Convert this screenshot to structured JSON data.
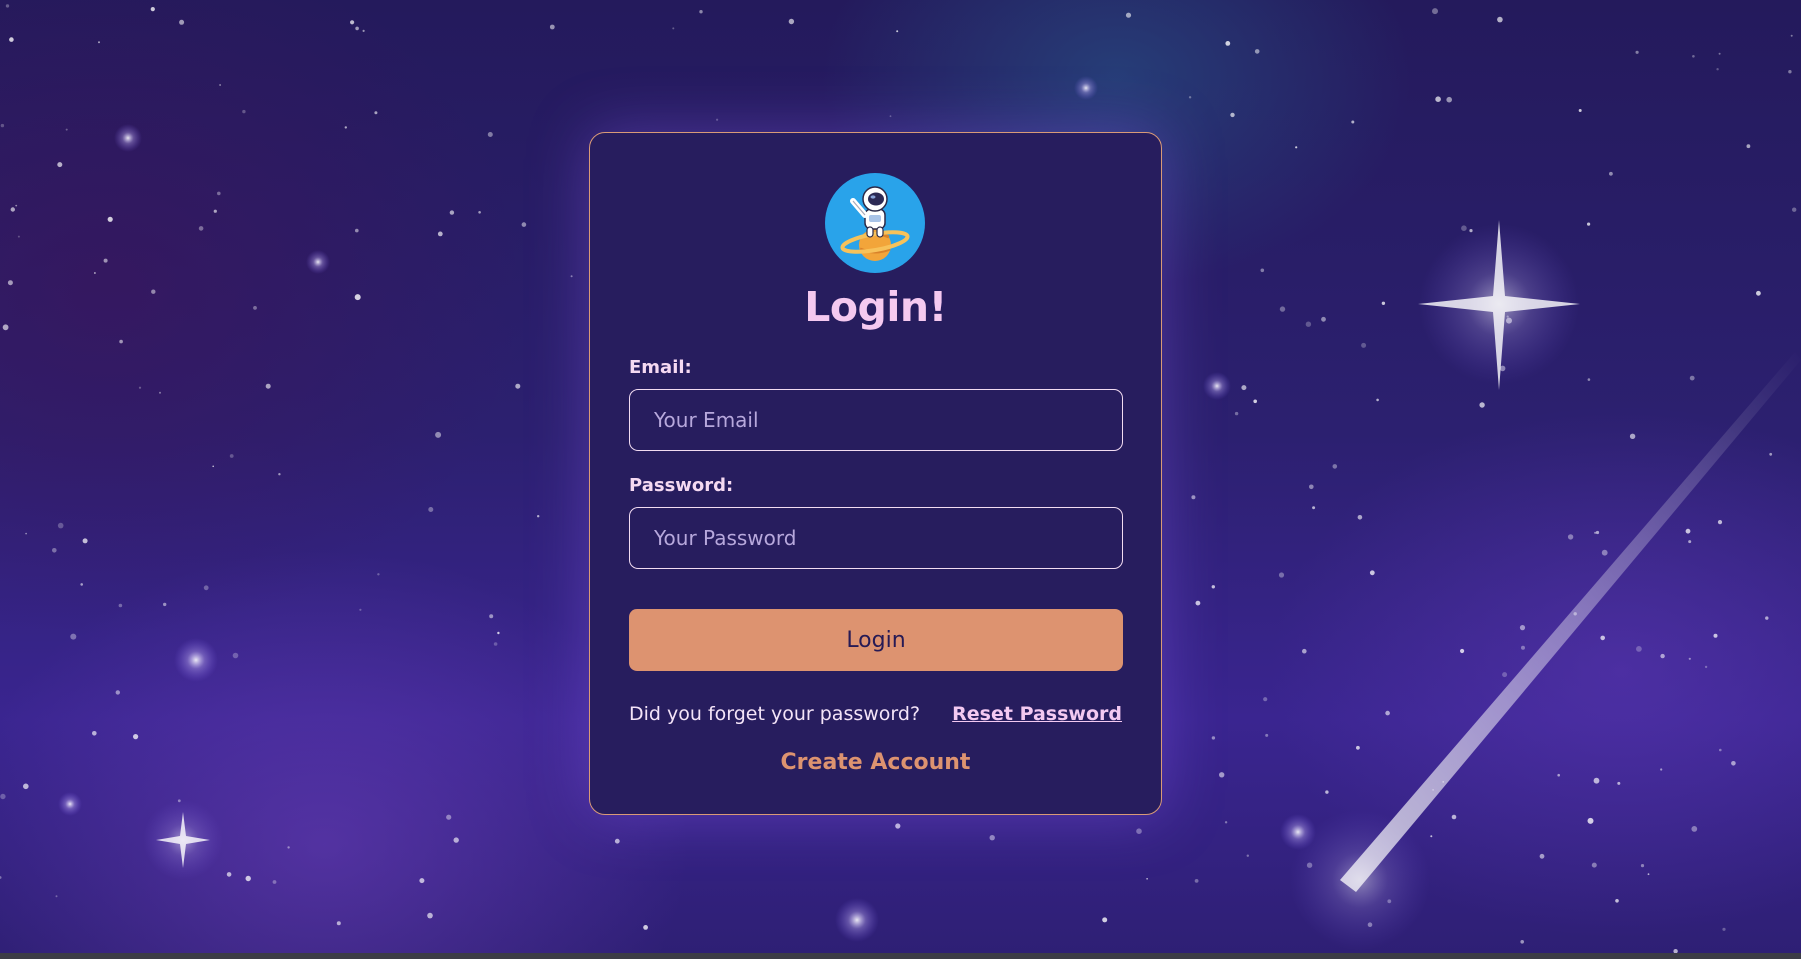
{
  "login_card": {
    "title": "Login!",
    "email": {
      "label": "Email:",
      "placeholder": "Your Email",
      "value": ""
    },
    "password": {
      "label": "Password:",
      "placeholder": "Your Password",
      "value": ""
    },
    "login_button_label": "Login",
    "forgot_text": "Did you forget your password?",
    "reset_link_label": "Reset Password",
    "create_account_label": "Create Account"
  },
  "icons": {
    "avatar": "astronaut-on-planet-icon"
  },
  "colors": {
    "background": "#2c2070",
    "card_background": "#271d5e",
    "card_border": "#d99a77",
    "accent": "#dd9370",
    "title": "#f5c9f0",
    "avatar_background": "#29a3ea"
  }
}
